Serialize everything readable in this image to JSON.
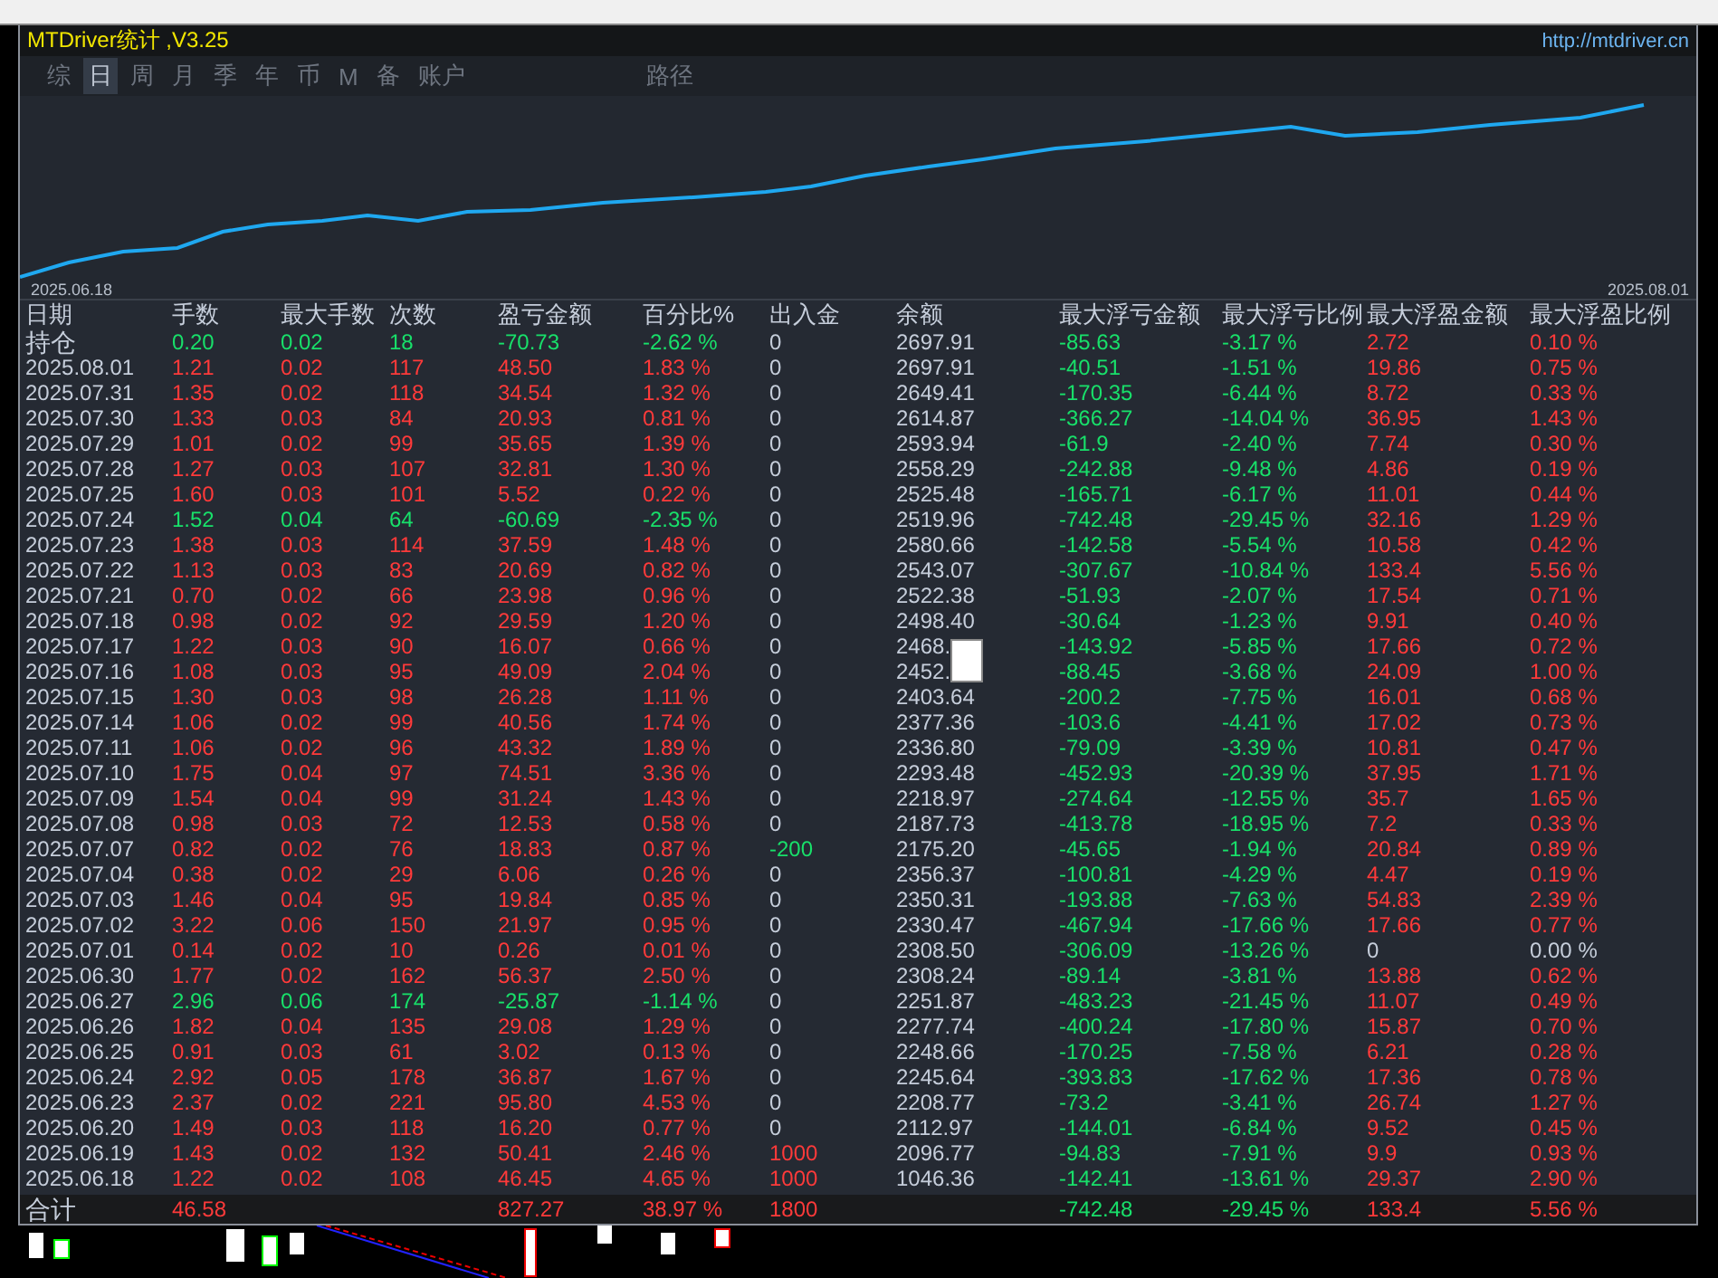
{
  "window": {
    "title": "MTDriver统计 ,V3.25",
    "link": "http://mtdriver.cn"
  },
  "tabs": [
    {
      "label": "综",
      "selected": false
    },
    {
      "label": "日",
      "selected": true
    },
    {
      "label": "周",
      "selected": false
    },
    {
      "label": "月",
      "selected": false
    },
    {
      "label": "季",
      "selected": false
    },
    {
      "label": "年",
      "selected": false
    },
    {
      "label": "币",
      "selected": false
    },
    {
      "label": "M",
      "selected": false
    },
    {
      "label": "备",
      "selected": false
    },
    {
      "label": "账户",
      "selected": false
    },
    {
      "label": "路径",
      "selected": false
    }
  ],
  "chart": {
    "start_label": "2025.06.18",
    "end_label": "2025.08.01"
  },
  "table": {
    "columns": [
      "日期",
      "手数",
      "最大手数",
      "次数",
      "盈亏金额",
      "百分比%",
      "出入金",
      "余额",
      "最大浮亏金额",
      "最大浮亏比例",
      "最大浮盈金额",
      "最大浮盈比例"
    ],
    "rows": [
      {
        "kind": "holding",
        "cells": [
          "持仓",
          "0.20",
          "0.02",
          "18",
          "-70.73",
          "-2.62 %",
          "0",
          "2697.91",
          "-85.63",
          "-3.17 %",
          "2.72",
          "0.10 %"
        ],
        "loss": true,
        "flow_in": false,
        "flow_out": false,
        "float_gain": true
      },
      {
        "kind": "day",
        "cells": [
          "2025.08.01",
          "1.21",
          "0.02",
          "117",
          "48.50",
          "1.83 %",
          "0",
          "2697.91",
          "-40.51",
          "-1.51 %",
          "19.86",
          "0.75 %"
        ],
        "loss": false,
        "flow_in": false,
        "flow_out": false,
        "float_gain": true
      },
      {
        "kind": "day",
        "cells": [
          "2025.07.31",
          "1.35",
          "0.02",
          "118",
          "34.54",
          "1.32 %",
          "0",
          "2649.41",
          "-170.35",
          "-6.44 %",
          "8.72",
          "0.33 %"
        ],
        "loss": false,
        "flow_in": false,
        "flow_out": false,
        "float_gain": true
      },
      {
        "kind": "day",
        "cells": [
          "2025.07.30",
          "1.33",
          "0.03",
          "84",
          "20.93",
          "0.81 %",
          "0",
          "2614.87",
          "-366.27",
          "-14.04 %",
          "36.95",
          "1.43 %"
        ],
        "loss": false,
        "flow_in": false,
        "flow_out": false,
        "float_gain": true
      },
      {
        "kind": "day",
        "cells": [
          "2025.07.29",
          "1.01",
          "0.02",
          "99",
          "35.65",
          "1.39 %",
          "0",
          "2593.94",
          "-61.9",
          "-2.40 %",
          "7.74",
          "0.30 %"
        ],
        "loss": false,
        "flow_in": false,
        "flow_out": false,
        "float_gain": true
      },
      {
        "kind": "day",
        "cells": [
          "2025.07.28",
          "1.27",
          "0.03",
          "107",
          "32.81",
          "1.30 %",
          "0",
          "2558.29",
          "-242.88",
          "-9.48 %",
          "4.86",
          "0.19 %"
        ],
        "loss": false,
        "flow_in": false,
        "flow_out": false,
        "float_gain": true
      },
      {
        "kind": "day",
        "cells": [
          "2025.07.25",
          "1.60",
          "0.03",
          "101",
          "5.52",
          "0.22 %",
          "0",
          "2525.48",
          "-165.71",
          "-6.17 %",
          "11.01",
          "0.44 %"
        ],
        "loss": false,
        "flow_in": false,
        "flow_out": false,
        "float_gain": true
      },
      {
        "kind": "day",
        "cells": [
          "2025.07.24",
          "1.52",
          "0.04",
          "64",
          "-60.69",
          "-2.35 %",
          "0",
          "2519.96",
          "-742.48",
          "-29.45 %",
          "32.16",
          "1.29 %"
        ],
        "loss": true,
        "flow_in": false,
        "flow_out": false,
        "float_gain": true
      },
      {
        "kind": "day",
        "cells": [
          "2025.07.23",
          "1.38",
          "0.03",
          "114",
          "37.59",
          "1.48 %",
          "0",
          "2580.66",
          "-142.58",
          "-5.54 %",
          "10.58",
          "0.42 %"
        ],
        "loss": false,
        "flow_in": false,
        "flow_out": false,
        "float_gain": true
      },
      {
        "kind": "day",
        "cells": [
          "2025.07.22",
          "1.13",
          "0.03",
          "83",
          "20.69",
          "0.82 %",
          "0",
          "2543.07",
          "-307.67",
          "-10.84 %",
          "133.4",
          "5.56 %"
        ],
        "loss": false,
        "flow_in": false,
        "flow_out": false,
        "float_gain": true
      },
      {
        "kind": "day",
        "cells": [
          "2025.07.21",
          "0.70",
          "0.02",
          "66",
          "23.98",
          "0.96 %",
          "0",
          "2522.38",
          "-51.93",
          "-2.07 %",
          "17.54",
          "0.71 %"
        ],
        "loss": false,
        "flow_in": false,
        "flow_out": false,
        "float_gain": true
      },
      {
        "kind": "day",
        "cells": [
          "2025.07.18",
          "0.98",
          "0.02",
          "92",
          "29.59",
          "1.20 %",
          "0",
          "2498.40",
          "-30.64",
          "-1.23 %",
          "9.91",
          "0.40 %"
        ],
        "loss": false,
        "flow_in": false,
        "flow_out": false,
        "float_gain": true
      },
      {
        "kind": "day",
        "cells": [
          "2025.07.17",
          "1.22",
          "0.03",
          "90",
          "16.07",
          "0.66 %",
          "0",
          "2468.",
          "-143.92",
          "-5.85 %",
          "17.66",
          "0.72 %"
        ],
        "loss": false,
        "flow_in": false,
        "flow_out": false,
        "float_gain": true
      },
      {
        "kind": "day",
        "cells": [
          "2025.07.16",
          "1.08",
          "0.03",
          "95",
          "49.09",
          "2.04 %",
          "0",
          "2452.",
          "-88.45",
          "-3.68 %",
          "24.09",
          "1.00 %"
        ],
        "loss": false,
        "flow_in": false,
        "flow_out": false,
        "float_gain": true
      },
      {
        "kind": "day",
        "cells": [
          "2025.07.15",
          "1.30",
          "0.03",
          "98",
          "26.28",
          "1.11 %",
          "0",
          "2403.64",
          "-200.2",
          "-7.75 %",
          "16.01",
          "0.68 %"
        ],
        "loss": false,
        "flow_in": false,
        "flow_out": false,
        "float_gain": true
      },
      {
        "kind": "day",
        "cells": [
          "2025.07.14",
          "1.06",
          "0.02",
          "99",
          "40.56",
          "1.74 %",
          "0",
          "2377.36",
          "-103.6",
          "-4.41 %",
          "17.02",
          "0.73 %"
        ],
        "loss": false,
        "flow_in": false,
        "flow_out": false,
        "float_gain": true
      },
      {
        "kind": "day",
        "cells": [
          "2025.07.11",
          "1.06",
          "0.02",
          "96",
          "43.32",
          "1.89 %",
          "0",
          "2336.80",
          "-79.09",
          "-3.39 %",
          "10.81",
          "0.47 %"
        ],
        "loss": false,
        "flow_in": false,
        "flow_out": false,
        "float_gain": true
      },
      {
        "kind": "day",
        "cells": [
          "2025.07.10",
          "1.75",
          "0.04",
          "97",
          "74.51",
          "3.36 %",
          "0",
          "2293.48",
          "-452.93",
          "-20.39 %",
          "37.95",
          "1.71 %"
        ],
        "loss": false,
        "flow_in": false,
        "flow_out": false,
        "float_gain": true
      },
      {
        "kind": "day",
        "cells": [
          "2025.07.09",
          "1.54",
          "0.04",
          "99",
          "31.24",
          "1.43 %",
          "0",
          "2218.97",
          "-274.64",
          "-12.55 %",
          "35.7",
          "1.65 %"
        ],
        "loss": false,
        "flow_in": false,
        "flow_out": false,
        "float_gain": true
      },
      {
        "kind": "day",
        "cells": [
          "2025.07.08",
          "0.98",
          "0.03",
          "72",
          "12.53",
          "0.58 %",
          "0",
          "2187.73",
          "-413.78",
          "-18.95 %",
          "7.2",
          "0.33 %"
        ],
        "loss": false,
        "flow_in": false,
        "flow_out": false,
        "float_gain": true
      },
      {
        "kind": "day",
        "cells": [
          "2025.07.07",
          "0.82",
          "0.02",
          "76",
          "18.83",
          "0.87 %",
          "-200",
          "2175.20",
          "-45.65",
          "-1.94 %",
          "20.84",
          "0.89 %"
        ],
        "loss": false,
        "flow_in": false,
        "flow_out": true,
        "float_gain": true
      },
      {
        "kind": "day",
        "cells": [
          "2025.07.04",
          "0.38",
          "0.02",
          "29",
          "6.06",
          "0.26 %",
          "0",
          "2356.37",
          "-100.81",
          "-4.29 %",
          "4.47",
          "0.19 %"
        ],
        "loss": false,
        "flow_in": false,
        "flow_out": false,
        "float_gain": true
      },
      {
        "kind": "day",
        "cells": [
          "2025.07.03",
          "1.46",
          "0.04",
          "95",
          "19.84",
          "0.85 %",
          "0",
          "2350.31",
          "-193.88",
          "-7.63 %",
          "54.83",
          "2.39 %"
        ],
        "loss": false,
        "flow_in": false,
        "flow_out": false,
        "float_gain": true
      },
      {
        "kind": "day",
        "cells": [
          "2025.07.02",
          "3.22",
          "0.06",
          "150",
          "21.97",
          "0.95 %",
          "0",
          "2330.47",
          "-467.94",
          "-17.66 %",
          "17.66",
          "0.77 %"
        ],
        "loss": false,
        "flow_in": false,
        "flow_out": false,
        "float_gain": true
      },
      {
        "kind": "day",
        "cells": [
          "2025.07.01",
          "0.14",
          "0.02",
          "10",
          "0.26",
          "0.01 %",
          "0",
          "2308.50",
          "-306.09",
          "-13.26 %",
          "0",
          "0.00 %"
        ],
        "loss": false,
        "flow_in": false,
        "flow_out": false,
        "float_gain": false
      },
      {
        "kind": "day",
        "cells": [
          "2025.06.30",
          "1.77",
          "0.02",
          "162",
          "56.37",
          "2.50 %",
          "0",
          "2308.24",
          "-89.14",
          "-3.81 %",
          "13.88",
          "0.62 %"
        ],
        "loss": false,
        "flow_in": false,
        "flow_out": false,
        "float_gain": true
      },
      {
        "kind": "day",
        "cells": [
          "2025.06.27",
          "2.96",
          "0.06",
          "174",
          "-25.87",
          "-1.14 %",
          "0",
          "2251.87",
          "-483.23",
          "-21.45 %",
          "11.07",
          "0.49 %"
        ],
        "loss": true,
        "flow_in": false,
        "flow_out": false,
        "float_gain": true
      },
      {
        "kind": "day",
        "cells": [
          "2025.06.26",
          "1.82",
          "0.04",
          "135",
          "29.08",
          "1.29 %",
          "0",
          "2277.74",
          "-400.24",
          "-17.80 %",
          "15.87",
          "0.70 %"
        ],
        "loss": false,
        "flow_in": false,
        "flow_out": false,
        "float_gain": true
      },
      {
        "kind": "day",
        "cells": [
          "2025.06.25",
          "0.91",
          "0.03",
          "61",
          "3.02",
          "0.13 %",
          "0",
          "2248.66",
          "-170.25",
          "-7.58 %",
          "6.21",
          "0.28 %"
        ],
        "loss": false,
        "flow_in": false,
        "flow_out": false,
        "float_gain": true
      },
      {
        "kind": "day",
        "cells": [
          "2025.06.24",
          "2.92",
          "0.05",
          "178",
          "36.87",
          "1.67 %",
          "0",
          "2245.64",
          "-393.83",
          "-17.62 %",
          "17.36",
          "0.78 %"
        ],
        "loss": false,
        "flow_in": false,
        "flow_out": false,
        "float_gain": true
      },
      {
        "kind": "day",
        "cells": [
          "2025.06.23",
          "2.37",
          "0.02",
          "221",
          "95.80",
          "4.53 %",
          "0",
          "2208.77",
          "-73.2",
          "-3.41 %",
          "26.74",
          "1.27 %"
        ],
        "loss": false,
        "flow_in": false,
        "flow_out": false,
        "float_gain": true
      },
      {
        "kind": "day",
        "cells": [
          "2025.06.20",
          "1.49",
          "0.03",
          "118",
          "16.20",
          "0.77 %",
          "0",
          "2112.97",
          "-144.01",
          "-6.84 %",
          "9.52",
          "0.45 %"
        ],
        "loss": false,
        "flow_in": false,
        "flow_out": false,
        "float_gain": true
      },
      {
        "kind": "day",
        "cells": [
          "2025.06.19",
          "1.43",
          "0.02",
          "132",
          "50.41",
          "2.46 %",
          "1000",
          "2096.77",
          "-94.83",
          "-7.91 %",
          "9.9",
          "0.93 %"
        ],
        "loss": false,
        "flow_in": true,
        "flow_out": false,
        "float_gain": true
      },
      {
        "kind": "day",
        "cells": [
          "2025.06.18",
          "1.22",
          "0.02",
          "108",
          "46.45",
          "4.65 %",
          "1000",
          "1046.36",
          "-142.41",
          "-13.61 %",
          "29.37",
          "2.90 %"
        ],
        "loss": false,
        "flow_in": true,
        "flow_out": false,
        "float_gain": true
      }
    ],
    "totals": {
      "label": "合计",
      "lots": "46.58",
      "pnl": "827.27",
      "pct": "38.97 %",
      "flow": "1800",
      "max_float_loss": "-742.48",
      "max_float_loss_pct": "-29.45 %",
      "max_float_profit": "133.4",
      "max_float_profit_pct": "5.56 %"
    }
  }
}
